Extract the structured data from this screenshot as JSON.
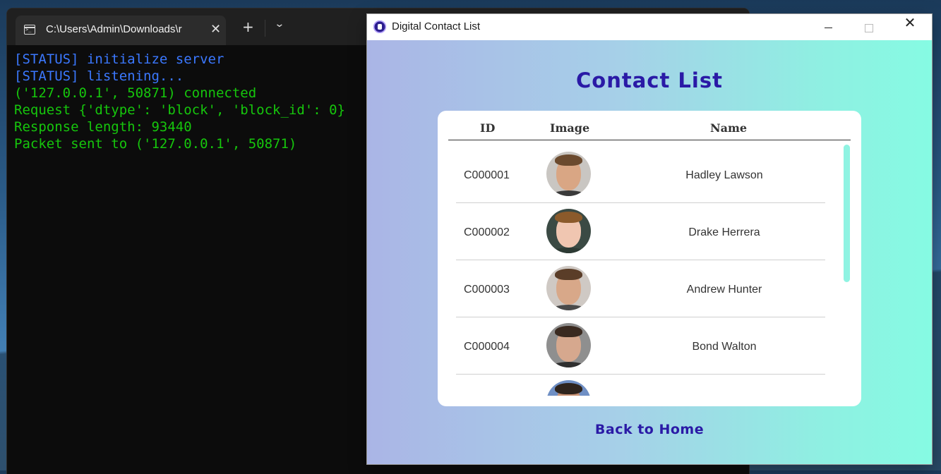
{
  "terminal": {
    "tab_title": "C:\\Users\\Admin\\Downloads\\r",
    "lines": [
      {
        "text": "[STATUS] initialize server",
        "color": "blue"
      },
      {
        "text": "[STATUS] listening...",
        "color": "blue"
      },
      {
        "text": "('127.0.0.1', 50871) connected",
        "color": "green"
      },
      {
        "text": "Request {'dtype': 'block', 'block_id': 0}",
        "color": "green"
      },
      {
        "text": "Response length: 93440",
        "color": "green"
      },
      {
        "text": "Packet sent to ('127.0.0.1', 50871)",
        "color": "green"
      }
    ]
  },
  "app": {
    "window_title": "Digital Contact List",
    "heading": "Contact List",
    "columns": {
      "id": "ID",
      "image": "Image",
      "name": "Name"
    },
    "contacts": [
      {
        "id": "C000001",
        "name": "Hadley Lawson",
        "avatar": {
          "skin": "#d9a684",
          "hair": "#6b4a2e",
          "bg": "#c9c6c2",
          "shirt": "#3a3a3a"
        }
      },
      {
        "id": "C000002",
        "name": "Drake Herrera",
        "avatar": {
          "skin": "#f0c6b1",
          "hair": "#8b5a2b",
          "bg": "#3b4a44",
          "shirt": "#2d3a34"
        }
      },
      {
        "id": "C000003",
        "name": "Andrew Hunter",
        "avatar": {
          "skin": "#d8a889",
          "hair": "#5a3d28",
          "bg": "#cfc9c4",
          "shirt": "#4a4a4a"
        }
      },
      {
        "id": "C000004",
        "name": "Bond Walton",
        "avatar": {
          "skin": "#d6a88e",
          "hair": "#3a2a20",
          "bg": "#8f8f8f",
          "shirt": "#2f2f2f"
        }
      },
      {
        "id": "",
        "name": "",
        "avatar": {
          "skin": "#c99274",
          "hair": "#2f241d",
          "bg": "#6f8fc4",
          "shirt": "#333"
        }
      }
    ],
    "back_link": "Back to Home"
  },
  "colors": {
    "heading": "#2a1aa6",
    "terminal_blue": "#3b78ff",
    "terminal_green": "#16c60c",
    "gradient_left": "#aab5e6",
    "gradient_right": "#86fbe3"
  },
  "icons": {
    "terminal_tab": "terminal-icon",
    "new_tab": "plus-icon",
    "dropdown": "chevron-down-icon",
    "app": "contact-book-icon",
    "minimize": "minimize-icon",
    "maximize": "maximize-icon",
    "close": "close-icon"
  }
}
